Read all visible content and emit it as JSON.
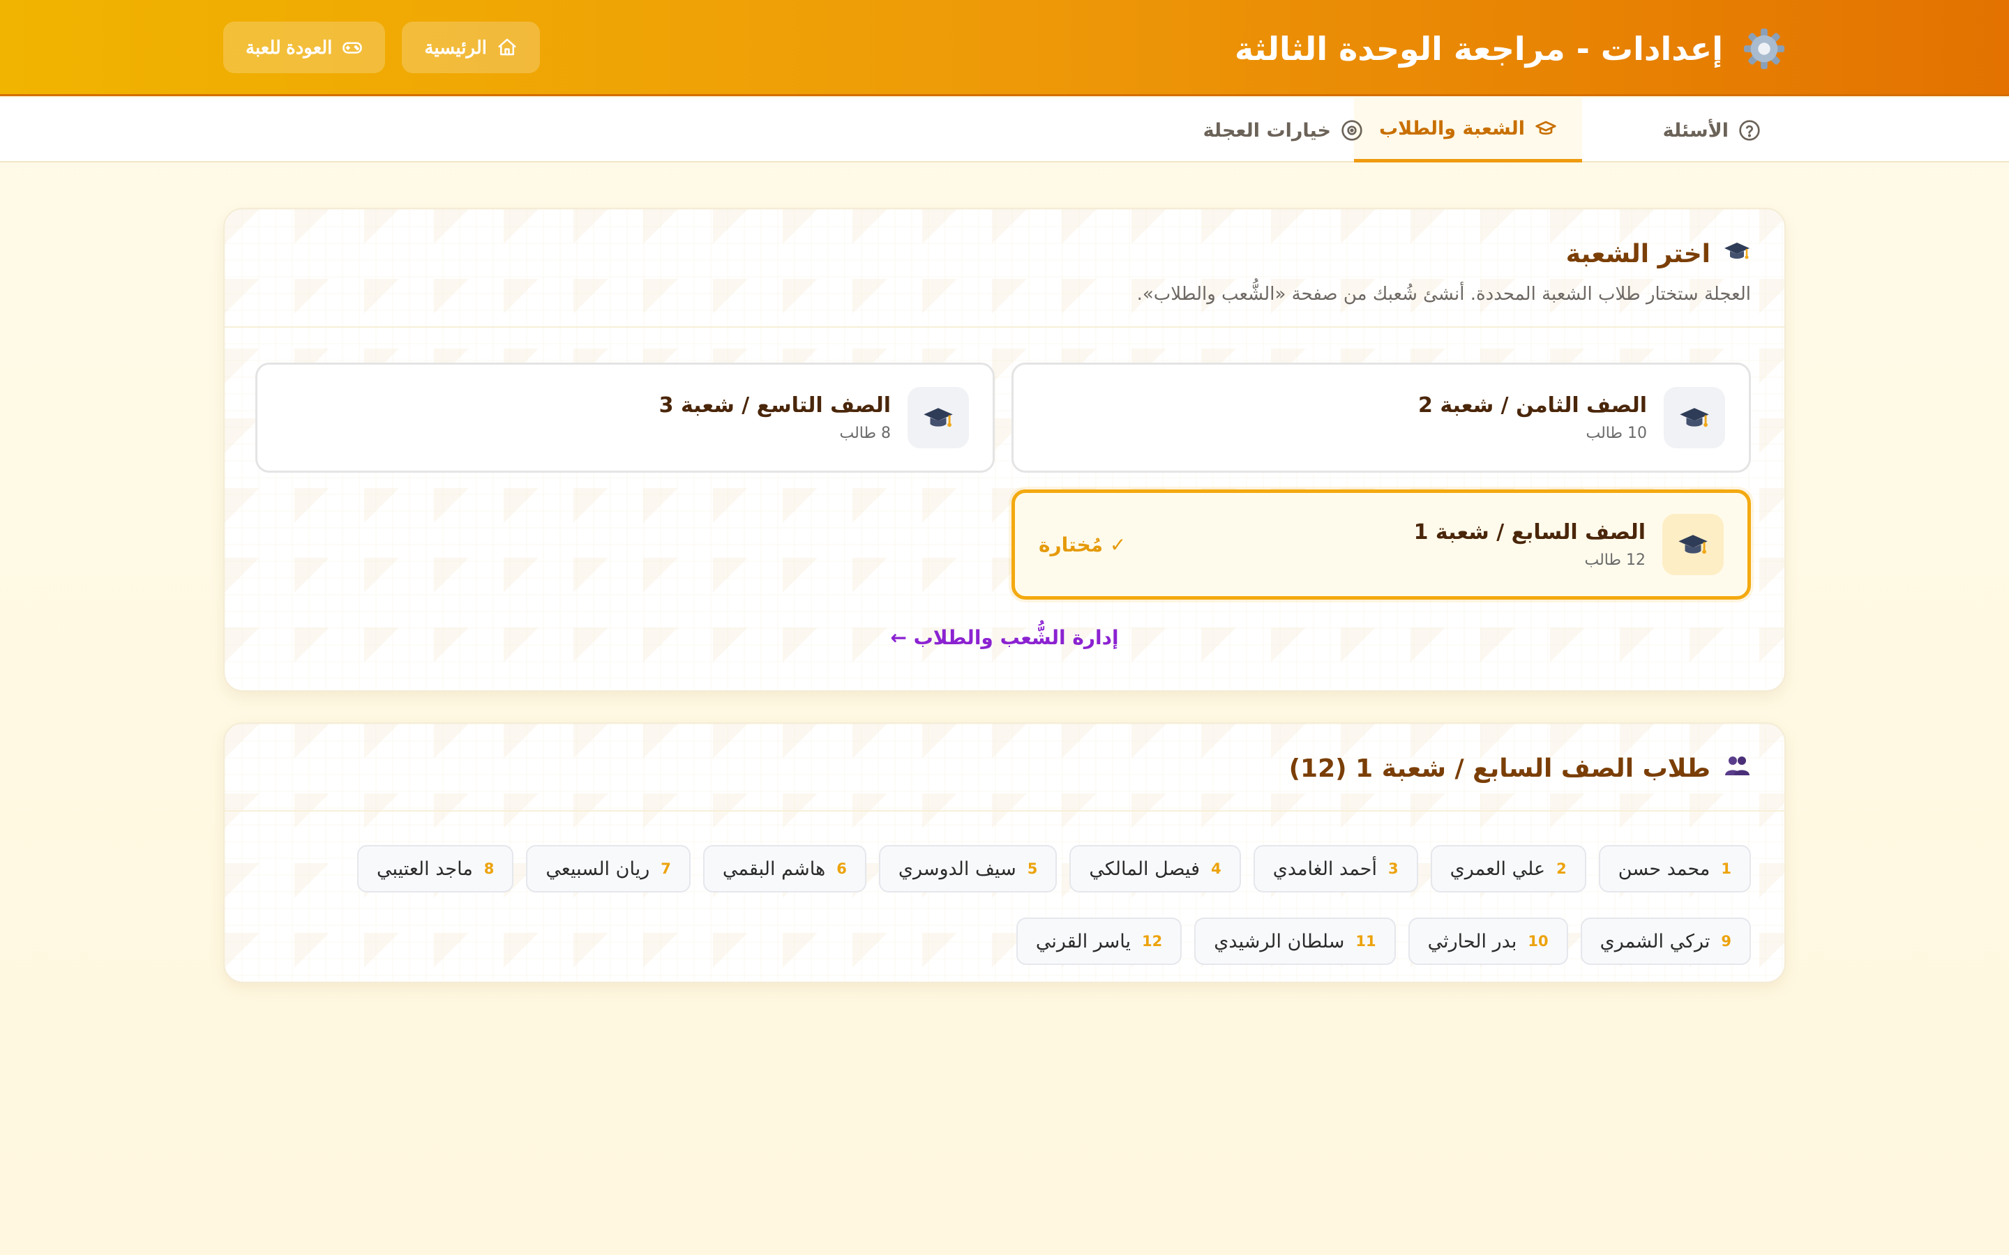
{
  "header": {
    "title": "إعدادات - مراجعة الوحدة الثالثة",
    "icon": "gear-icon",
    "buttons": {
      "back_to_game": "العودة للعبة",
      "home": "الرئيسية"
    }
  },
  "tabs": [
    {
      "label": "الأسئلة",
      "icon": "question-circle-icon",
      "active": false
    },
    {
      "label": "الشعبة والطلاب",
      "icon": "graduation-cap-icon",
      "active": true
    },
    {
      "label": "خيارات العجلة",
      "icon": "wheel-icon",
      "active": false
    }
  ],
  "class_section": {
    "title": "اختر الشعبة",
    "subtitle": "العجلة ستختار طلاب الشعبة المحددة. أنشئ شُعبك من صفحة «الشُّعب والطلاب».",
    "classes": [
      {
        "name": "الصف الثامن / شعبة 2",
        "count": "10 طالب",
        "selected": false
      },
      {
        "name": "الصف التاسع / شعبة 3",
        "count": "8 طالب",
        "selected": false
      },
      {
        "name": "الصف السابع / شعبة 1",
        "count": "12 طالب",
        "selected": true,
        "badge": "✓ مُختارة"
      }
    ],
    "manage_link": "إدارة الشُّعب والطلاب ←"
  },
  "students_section": {
    "title": "طلاب الصف السابع / شعبة 1 (12)",
    "students": [
      {
        "num": "1",
        "name": "محمد حسن"
      },
      {
        "num": "2",
        "name": "علي العمري"
      },
      {
        "num": "3",
        "name": "أحمد الغامدي"
      },
      {
        "num": "4",
        "name": "فيصل المالكي"
      },
      {
        "num": "5",
        "name": "سيف الدوسري"
      },
      {
        "num": "6",
        "name": "هاشم البقمي"
      },
      {
        "num": "7",
        "name": "ريان السبيعي"
      },
      {
        "num": "8",
        "name": "ماجد العتيبي"
      },
      {
        "num": "9",
        "name": "تركي الشمري"
      },
      {
        "num": "10",
        "name": "بدر الحارثي"
      },
      {
        "num": "11",
        "name": "سلطان الرشيدي"
      },
      {
        "num": "12",
        "name": "ياسر القرني"
      }
    ]
  },
  "colors": {
    "header_start": "#f1b400",
    "header_end": "#e37200",
    "accent": "#ef9a10",
    "link": "#8b22d1",
    "title": "#7a3e06"
  }
}
